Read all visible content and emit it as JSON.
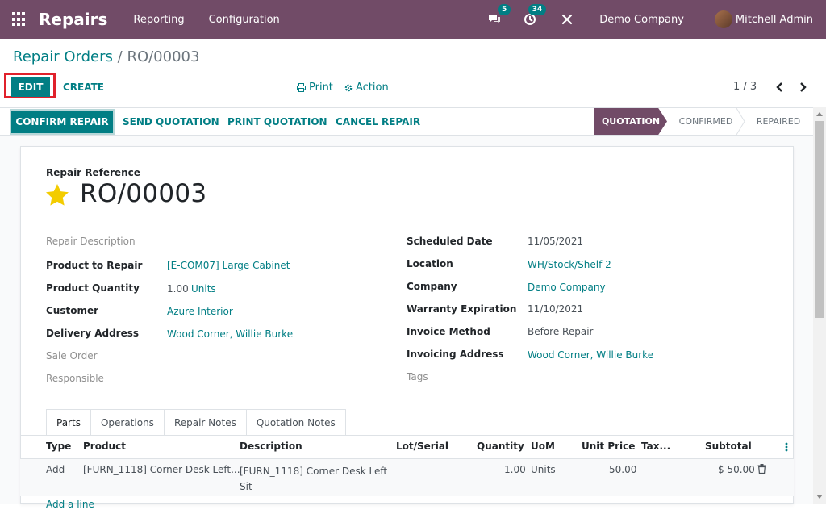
{
  "navbar": {
    "app_name": "Repairs",
    "menus": [
      "Reporting",
      "Configuration"
    ],
    "messages_count": "5",
    "activities_count": "34",
    "company": "Demo Company",
    "user": "Mitchell Admin",
    "brand_color": "#714B67",
    "accent_color": "#017E84"
  },
  "breadcrumb": {
    "parent": "Repair Orders",
    "separator": "/",
    "current": "RO/00003"
  },
  "controls": {
    "edit_label": "EDIT",
    "create_label": "CREATE",
    "print_label": "Print",
    "action_label": "Action",
    "pager": "1 / 3"
  },
  "statusbar": {
    "buttons": [
      "CONFIRM REPAIR",
      "SEND QUOTATION",
      "PRINT QUOTATION",
      "CANCEL REPAIR"
    ],
    "stages": [
      "QUOTATION",
      "CONFIRMED",
      "REPAIRED"
    ],
    "active_stage": "QUOTATION"
  },
  "form": {
    "ref_label": "Repair Reference",
    "ref_value": "RO/00003",
    "starred": true,
    "left_fields": [
      {
        "label": "Repair Description",
        "value": ""
      },
      {
        "label": "Product to Repair",
        "value": "[E-COM07] Large Cabinet"
      },
      {
        "label": "Product Quantity",
        "value": "1.00",
        "unit": "Units"
      },
      {
        "label": "Customer",
        "value": "Azure Interior"
      },
      {
        "label": "Delivery Address",
        "value": "Wood Corner, Willie Burke"
      },
      {
        "label": "Sale Order",
        "value": ""
      },
      {
        "label": "Responsible",
        "value": ""
      }
    ],
    "right_fields": [
      {
        "label": "Scheduled Date",
        "value": "11/05/2021"
      },
      {
        "label": "Location",
        "value": "WH/Stock/Shelf 2"
      },
      {
        "label": "Company",
        "value": "Demo Company"
      },
      {
        "label": "Warranty Expiration",
        "value": "11/10/2021"
      },
      {
        "label": "Invoice Method",
        "value": "Before Repair"
      },
      {
        "label": "Invoicing Address",
        "value": "Wood Corner, Willie Burke"
      },
      {
        "label": "Tags",
        "value": ""
      }
    ]
  },
  "tabs": [
    "Parts",
    "Operations",
    "Repair Notes",
    "Quotation Notes"
  ],
  "active_tab": "Parts",
  "table": {
    "headers": [
      "Type",
      "Product",
      "Description",
      "Lot/Serial",
      "Quantity",
      "UoM",
      "Unit Price",
      "Tax...",
      "Subtotal"
    ],
    "rows": [
      {
        "type": "Add",
        "product": "[FURN_1118] Corner Desk Left...",
        "description": "[FURN_1118] Corner Desk Left Sit",
        "lot": "",
        "quantity": "1.00",
        "uom": "Units",
        "unit_price": "50.00",
        "taxes": "",
        "subtotal": "$ 50.00"
      }
    ],
    "add_line_label": "Add a line"
  }
}
